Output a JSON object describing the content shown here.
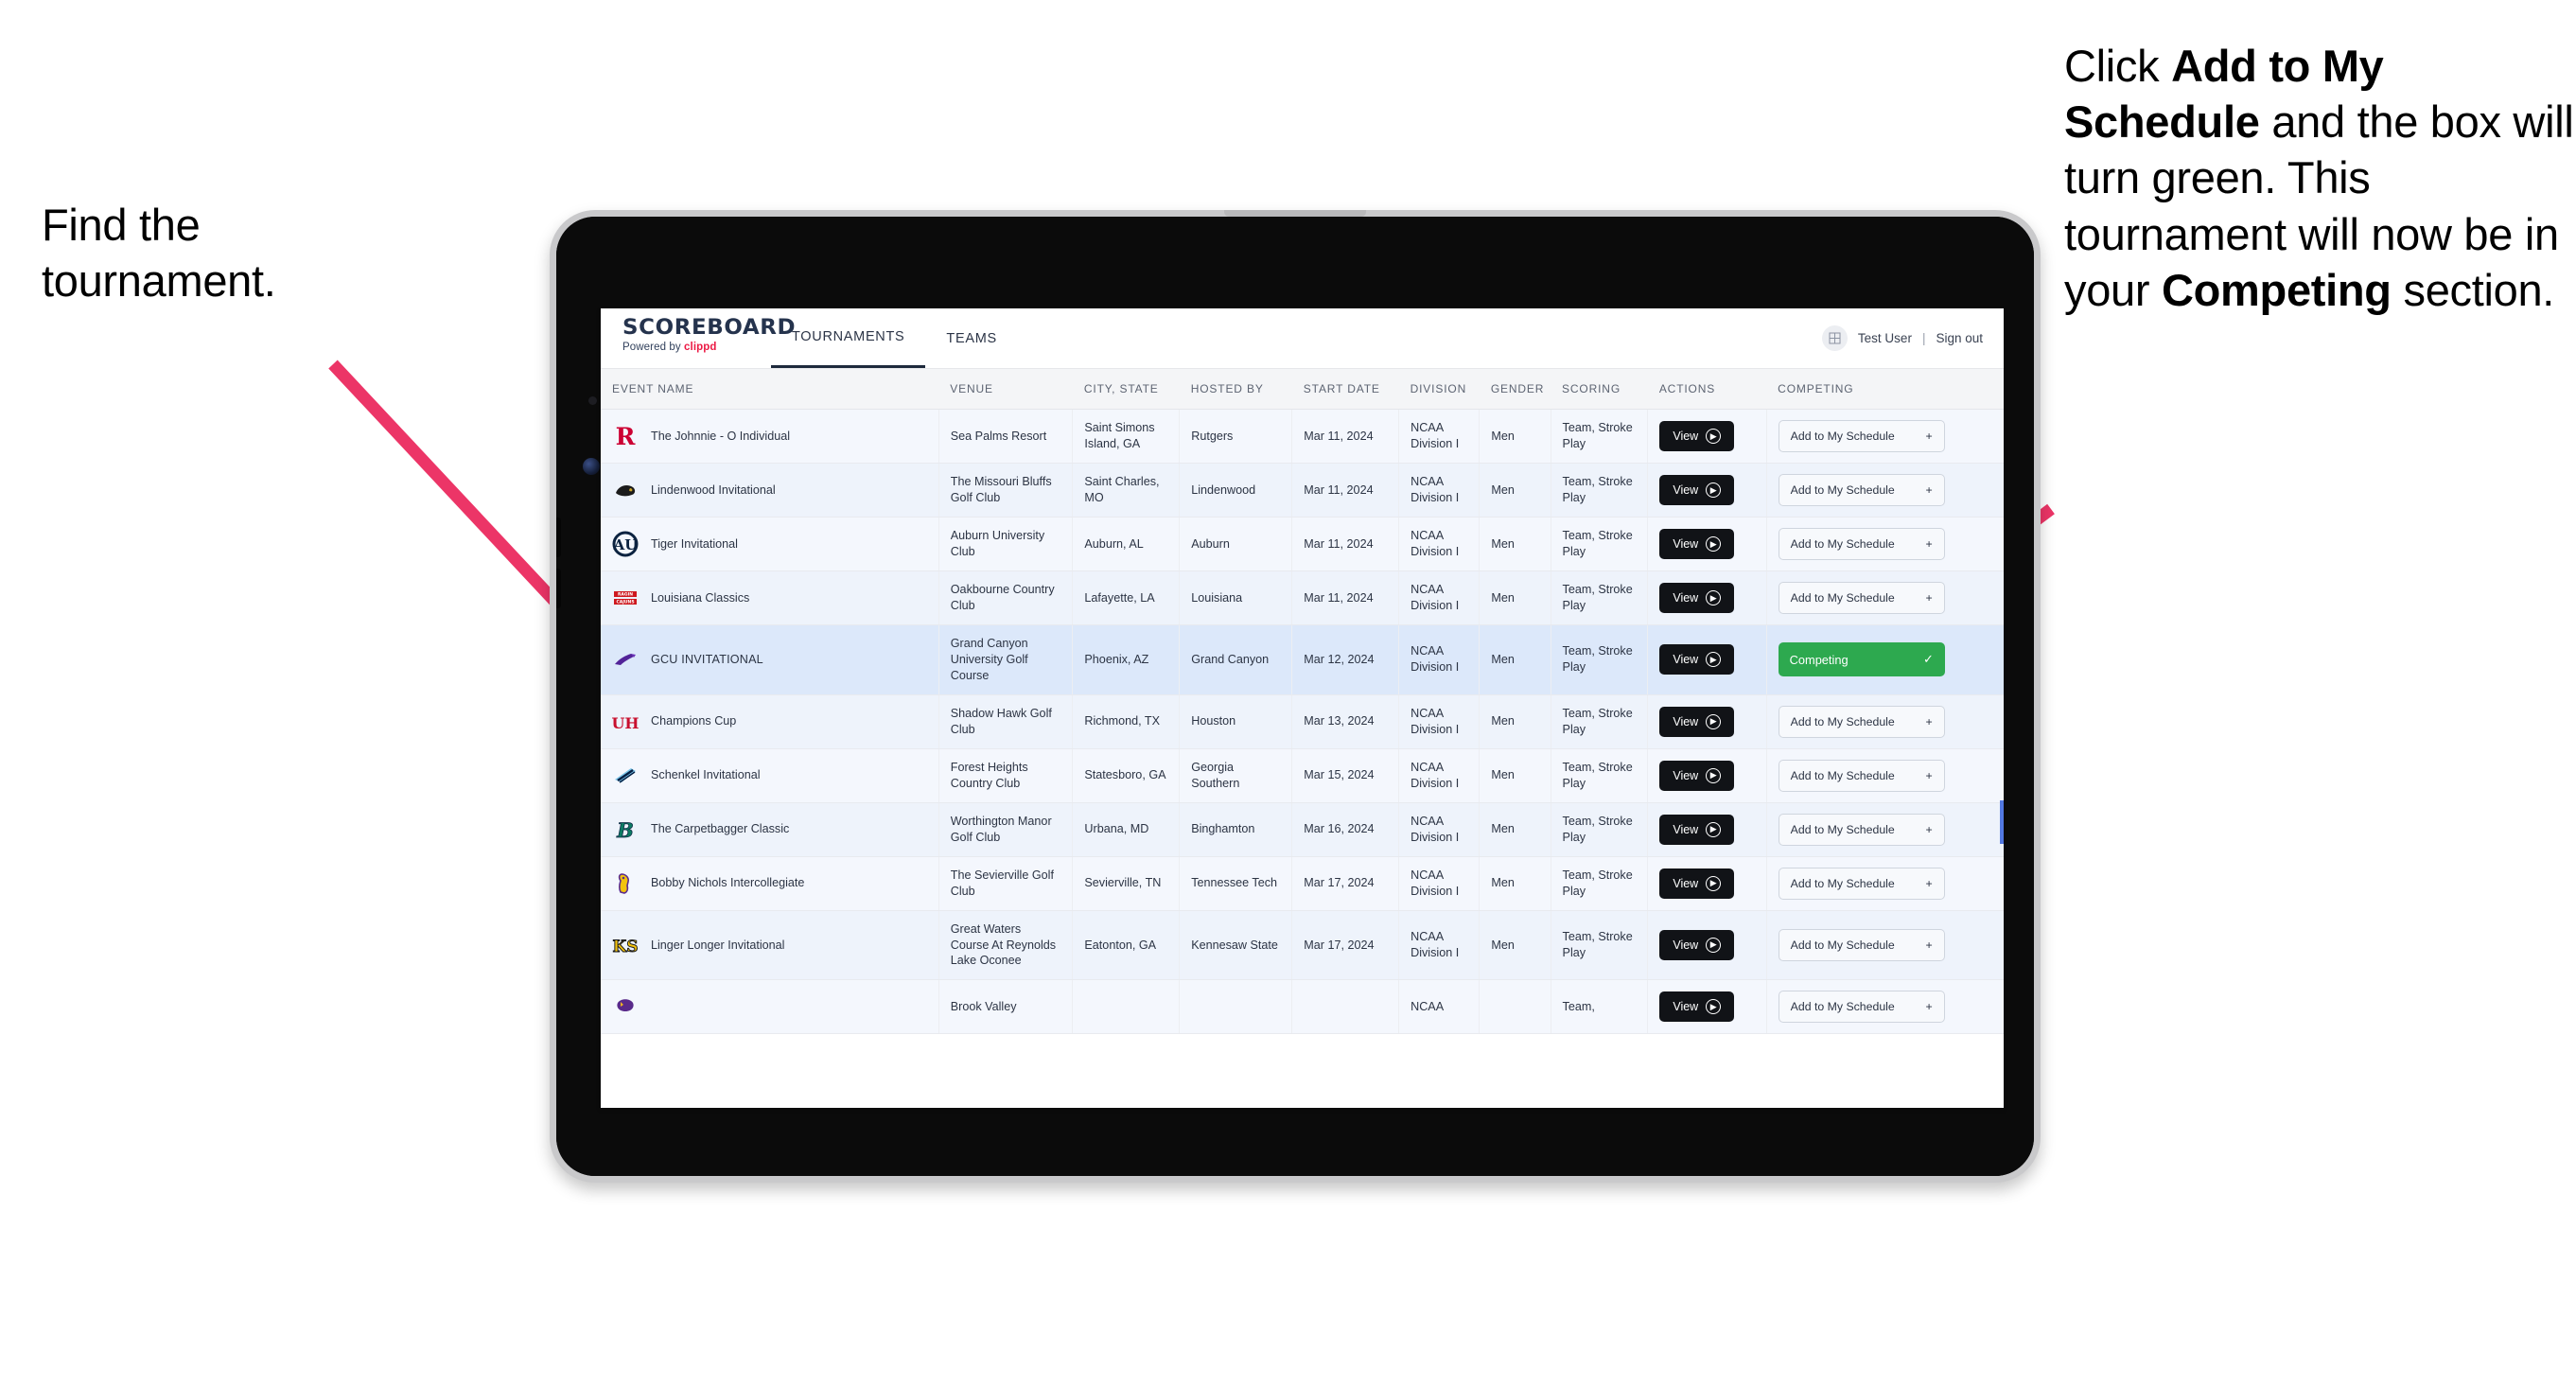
{
  "annotations": {
    "left": {
      "lines": [
        "Find the",
        "tournament."
      ]
    },
    "right": {
      "segments": [
        {
          "text": "Click ",
          "bold": false
        },
        {
          "text": "Add to My Schedule",
          "bold": true
        },
        {
          "text": " and the box will turn green. This tournament will now be in your ",
          "bold": false
        },
        {
          "text": "Competing",
          "bold": true
        },
        {
          "text": " section.",
          "bold": false
        }
      ]
    },
    "arrow_color": "#ec3567"
  },
  "app": {
    "brand": {
      "name": "SCOREBOARD",
      "powered_prefix": "Powered by ",
      "powered_brand": "clippd"
    },
    "tabs": [
      {
        "label": "TOURNAMENTS",
        "active": true
      },
      {
        "label": "TEAMS",
        "active": false
      }
    ],
    "user": {
      "avatar_icon": "grid-icon",
      "name": "Test User",
      "separator": "|",
      "sign_out": "Sign out"
    },
    "table": {
      "columns": [
        "EVENT NAME",
        "VENUE",
        "CITY, STATE",
        "HOSTED BY",
        "START DATE",
        "DIVISION",
        "GENDER",
        "SCORING",
        "ACTIONS",
        "COMPETING"
      ],
      "view_label": "View",
      "add_label": "Add to My Schedule",
      "add_icon": "plus-icon",
      "competing_label": "Competing",
      "competing_icon": "check-icon",
      "competing_color": "#2da94f",
      "rows": [
        {
          "event": "The Johnnie - O Individual",
          "venue": "Sea Palms Resort",
          "city": "Saint Simons Island, GA",
          "host": "Rutgers",
          "date": "Mar 11, 2024",
          "division": "NCAA Division I",
          "gender": "Men",
          "scoring": "Team, Stroke Play",
          "competing": false,
          "logo": "rutgers-r-logo"
        },
        {
          "event": "Lindenwood Invitational",
          "venue": "The Missouri Bluffs Golf Club",
          "city": "Saint Charles, MO",
          "host": "Lindenwood",
          "date": "Mar 11, 2024",
          "division": "NCAA Division I",
          "gender": "Men",
          "scoring": "Team, Stroke Play",
          "competing": false,
          "logo": "lindenwood-lion-logo"
        },
        {
          "event": "Tiger Invitational",
          "venue": "Auburn University Club",
          "city": "Auburn, AL",
          "host": "Auburn",
          "date": "Mar 11, 2024",
          "division": "NCAA Division I",
          "gender": "Men",
          "scoring": "Team, Stroke Play",
          "competing": false,
          "logo": "auburn-au-logo"
        },
        {
          "event": "Louisiana Classics",
          "venue": "Oakbourne Country Club",
          "city": "Lafayette, LA",
          "host": "Louisiana",
          "date": "Mar 11, 2024",
          "division": "NCAA Division I",
          "gender": "Men",
          "scoring": "Team, Stroke Play",
          "competing": false,
          "logo": "louisiana-ragin-cajuns-logo"
        },
        {
          "event": "GCU INVITATIONAL",
          "venue": "Grand Canyon University Golf Course",
          "city": "Phoenix, AZ",
          "host": "Grand Canyon",
          "date": "Mar 12, 2024",
          "division": "NCAA Division I",
          "gender": "Men",
          "scoring": "Team, Stroke Play",
          "competing": true,
          "logo": "grand-canyon-lope-logo"
        },
        {
          "event": "Champions Cup",
          "venue": "Shadow Hawk Golf Club",
          "city": "Richmond, TX",
          "host": "Houston",
          "date": "Mar 13, 2024",
          "division": "NCAA Division I",
          "gender": "Men",
          "scoring": "Team, Stroke Play",
          "competing": false,
          "logo": "houston-uh-logo"
        },
        {
          "event": "Schenkel Invitational",
          "venue": "Forest Heights Country Club",
          "city": "Statesboro, GA",
          "host": "Georgia Southern",
          "date": "Mar 15, 2024",
          "division": "NCAA Division I",
          "gender": "Men",
          "scoring": "Team, Stroke Play",
          "competing": false,
          "logo": "georgia-southern-eagle-logo"
        },
        {
          "event": "The Carpetbagger Classic",
          "venue": "Worthington Manor Golf Club",
          "city": "Urbana, MD",
          "host": "Binghamton",
          "date": "Mar 16, 2024",
          "division": "NCAA Division I",
          "gender": "Men",
          "scoring": "Team, Stroke Play",
          "competing": false,
          "logo": "binghamton-b-logo"
        },
        {
          "event": "Bobby Nichols Intercollegiate",
          "venue": "The Sevierville Golf Club",
          "city": "Sevierville, TN",
          "host": "Tennessee Tech",
          "date": "Mar 17, 2024",
          "division": "NCAA Division I",
          "gender": "Men",
          "scoring": "Team, Stroke Play",
          "competing": false,
          "logo": "tennessee-tech-eagle-logo"
        },
        {
          "event": "Linger Longer Invitational",
          "venue": "Great Waters Course At Reynolds Lake Oconee",
          "city": "Eatonton, GA",
          "host": "Kennesaw State",
          "date": "Mar 17, 2024",
          "division": "NCAA Division I",
          "gender": "Men",
          "scoring": "Team, Stroke Play",
          "competing": false,
          "logo": "kennesaw-state-ks-logo"
        },
        {
          "event": "",
          "venue": "Brook Valley",
          "city": "",
          "host": "",
          "date": "",
          "division": "NCAA",
          "gender": "",
          "scoring": "Team,",
          "competing": false,
          "logo": "east-carolina-logo",
          "partial": true
        }
      ]
    }
  }
}
